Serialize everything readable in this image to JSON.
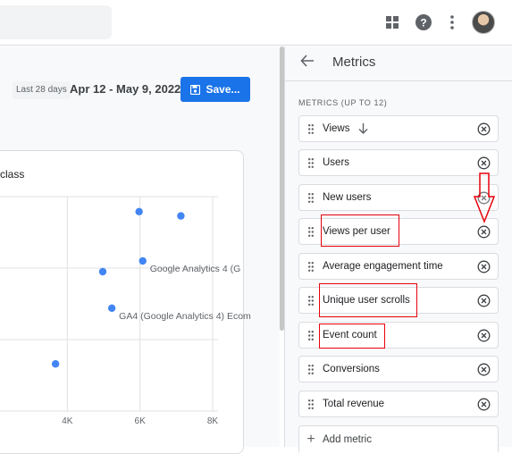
{
  "header": {
    "icons": [
      "apps-grid-icon",
      "help-icon",
      "more-vert-icon"
    ]
  },
  "report": {
    "date_label": "Last 28 days",
    "date_range": "Apr 12 - May 9, 2022",
    "save_label": "Save...",
    "chart_title_fragment": "class"
  },
  "chart_data": {
    "type": "scatter",
    "title": "class",
    "x_ticks": [
      "4K",
      "6K",
      "8K"
    ],
    "points": [
      {
        "x": 6000,
        "y": 0.93,
        "label": ""
      },
      {
        "x": 7150,
        "y": 0.91,
        "label": ""
      },
      {
        "x": 5000,
        "y": 0.65,
        "label": ""
      },
      {
        "x": 6100,
        "y": 0.7,
        "label": "Google Analytics 4 (G"
      },
      {
        "x": 5250,
        "y": 0.48,
        "label": "GA4 (Google Analytics 4) Ecom"
      },
      {
        "x": 3700,
        "y": 0.22,
        "label": ""
      }
    ],
    "point_color": "#4285f4"
  },
  "panel": {
    "title": "Metrics",
    "section_label": "METRICS (UP TO 12)",
    "metrics": [
      {
        "label": "Views",
        "sorted": true
      },
      {
        "label": "Users"
      },
      {
        "label": "New users"
      },
      {
        "label": "Views per user"
      },
      {
        "label": "Average engagement time"
      },
      {
        "label": "Unique user scrolls"
      },
      {
        "label": "Event count"
      },
      {
        "label": "Conversions"
      },
      {
        "label": "Total revenue"
      }
    ],
    "add_label": "Add metric"
  },
  "annotation_color": "#e8000b"
}
